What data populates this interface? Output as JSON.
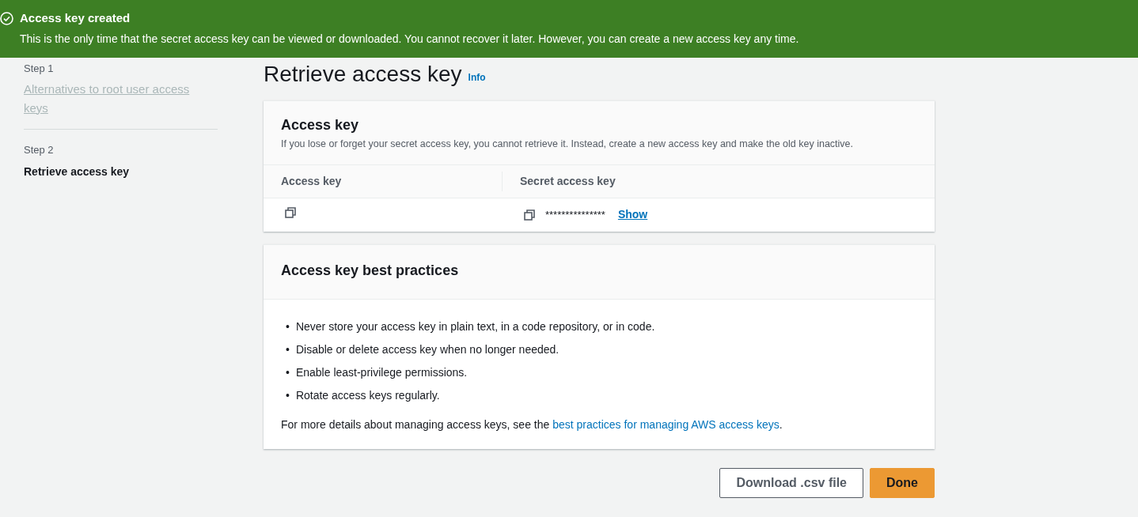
{
  "banner": {
    "title": "Access key created",
    "message": "This is the only time that the secret access key can be viewed or downloaded. You cannot recover it later. However, you can create a new access key any time."
  },
  "steps": [
    {
      "label": "Step 1",
      "title": "Alternatives to root user access keys",
      "selected": false
    },
    {
      "label": "Step 2",
      "title": "Retrieve access key",
      "selected": true
    }
  ],
  "page": {
    "title": "Retrieve access key",
    "info": "Info"
  },
  "access_key_panel": {
    "title": "Access key",
    "description": "If you lose or forget your secret access key, you cannot retrieve it. Instead, create a new access key and make the old key inactive.",
    "columns": [
      "Access key",
      "Secret access key"
    ],
    "secret": "***************",
    "show_link": "Show"
  },
  "practices_panel": {
    "title": "Access key best practices",
    "items": [
      {
        "bullet": "•",
        "text": "Never store your access key in plain text, in a code repository, or in code."
      },
      {
        "bullet": "•",
        "text": "Disable or delete access key when no longer needed."
      },
      {
        "bullet": "•",
        "text": "Enable least-privilege permissions."
      },
      {
        "bullet": "•",
        "text": "Rotate access keys regularly."
      }
    ],
    "footer": "For more details about managing access keys, see the ",
    "footer_link": "best practices for managing AWS access keys",
    "footer_end": "."
  },
  "buttons": [
    {
      "label": "Download .csv file",
      "kind": "secondary"
    },
    {
      "label": "Done",
      "kind": "primary"
    }
  ]
}
